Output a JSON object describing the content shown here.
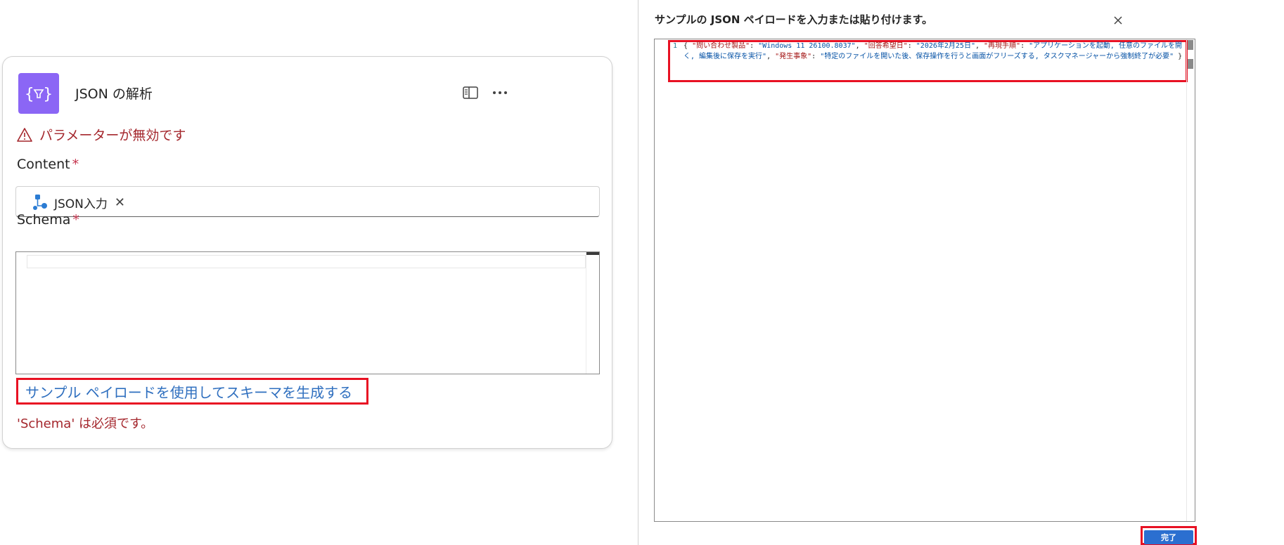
{
  "card": {
    "title": "JSON の解析",
    "warning": "パラメーターが無効です",
    "content_label": "Content",
    "schema_label": "Schema",
    "required_mark": "*",
    "content_token": "JSON入力",
    "token_remove": "✕",
    "generate_link": "サンプル ペイロードを使用してスキーマを生成する",
    "schema_required_msg": "'Schema' は必須です。"
  },
  "panel": {
    "title": "サンプルの JSON ペイロードを入力または貼り付けます。",
    "line_number": "1",
    "code": {
      "open": "{",
      "k1": "\"問い合わせ製品\"",
      "v1": "\"Windows 11 26100.8037\"",
      "k2": "\"回答希望日\"",
      "v2": "\"2026年2月25日\"",
      "k3": "\"再現手順\"",
      "v3": "\"アプリケーションを起動, 任意のファイルを開く, 編集後に保存を実行\"",
      "k4": "\"発生事象\"",
      "v4": "\"特定のファイルを開いた後、保存操作を行うと画面がフリーズする, タスクマネージャーから強制終了が必要\"",
      "close": "}"
    },
    "done_label": "完了"
  },
  "colors": {
    "accent_purple": "#8b66f5",
    "error_red": "#a4262c",
    "link_blue": "#2f6fbf",
    "highlight_red": "#e81123",
    "button_blue": "#2b6fd0"
  }
}
